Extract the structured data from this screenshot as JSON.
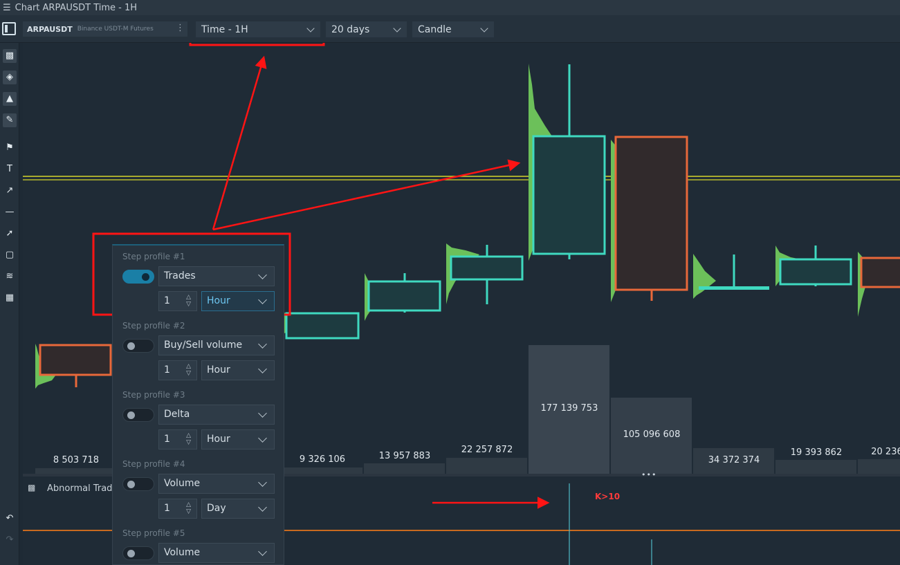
{
  "window": {
    "menu_icon": "hamburger-icon",
    "title": "Chart ARPAUSDT Time - 1H"
  },
  "toolbar": {
    "symbol": "ARPAUSDT",
    "exchange": "Binance USDT-M Futures",
    "timeframe": "Time - 1H",
    "period": "20 days",
    "chart_type": "Candle"
  },
  "left_tools": [
    "bar-chart-icon",
    "layers-icon",
    "bell-icon",
    "pencil-icon",
    "flag-icon",
    "text-icon",
    "arrow-icon",
    "horizontal-line-icon",
    "trend-line-icon",
    "rectangle-icon",
    "brush-icon",
    "ruler-icon",
    "undo-icon",
    "redo-icon"
  ],
  "indicator": {
    "label": "Abnormal Trad"
  },
  "step_profiles": [
    {
      "title": "Step profile #1",
      "enabled": true,
      "source": "Trades",
      "count": "1",
      "unit": "Hour"
    },
    {
      "title": "Step profile #2",
      "enabled": false,
      "source": "Buy/Sell volume",
      "count": "1",
      "unit": "Hour"
    },
    {
      "title": "Step profile #3",
      "enabled": false,
      "source": "Delta",
      "count": "1",
      "unit": "Hour"
    },
    {
      "title": "Step profile #4",
      "enabled": false,
      "source": "Volume",
      "count": "1",
      "unit": "Day"
    },
    {
      "title": "Step profile #5",
      "enabled": false,
      "source": "Volume",
      "count": "",
      "unit": ""
    }
  ],
  "volumes": [
    "8 503 718",
    "9 326 106",
    "13 957 883",
    "22 257 872",
    "177 139 753",
    "105 096 608",
    "34 372 374",
    "19 393 862",
    "20 236"
  ],
  "annotation": "K>10",
  "colors": {
    "bull": "#3fd9c0",
    "bear": "#e8683a",
    "profile": "#6cc05a",
    "level": "#d6d62a",
    "highlight": "#ff1414"
  }
}
